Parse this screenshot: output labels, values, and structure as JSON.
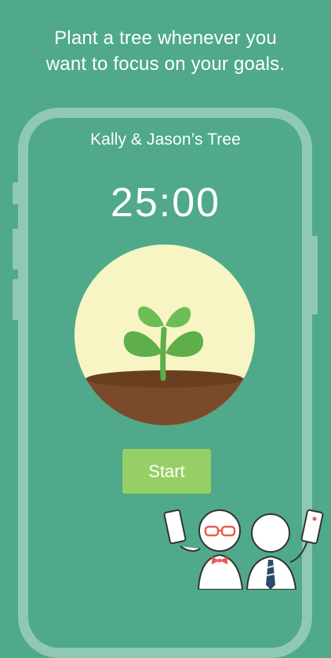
{
  "headline": {
    "line1": "Plant a tree whenever you",
    "line2": "want to focus on your goals."
  },
  "session": {
    "tree_title": "Kally & Jason’s Tree",
    "timer": "25:00"
  },
  "actions": {
    "start_label": "Start"
  },
  "colors": {
    "background": "#4fa98a",
    "phone_frame": "#8fc9b5",
    "start_button": "#95cf65",
    "sun_circle": "#f7f5c3",
    "soil": "#7a4a2a",
    "leaf": "#5fae4b"
  },
  "icons": {
    "plant": "sapling-in-soil-icon",
    "mascot_left": "person-with-glasses-and-bowtie-icon",
    "mascot_right": "person-with-tie-icon"
  }
}
